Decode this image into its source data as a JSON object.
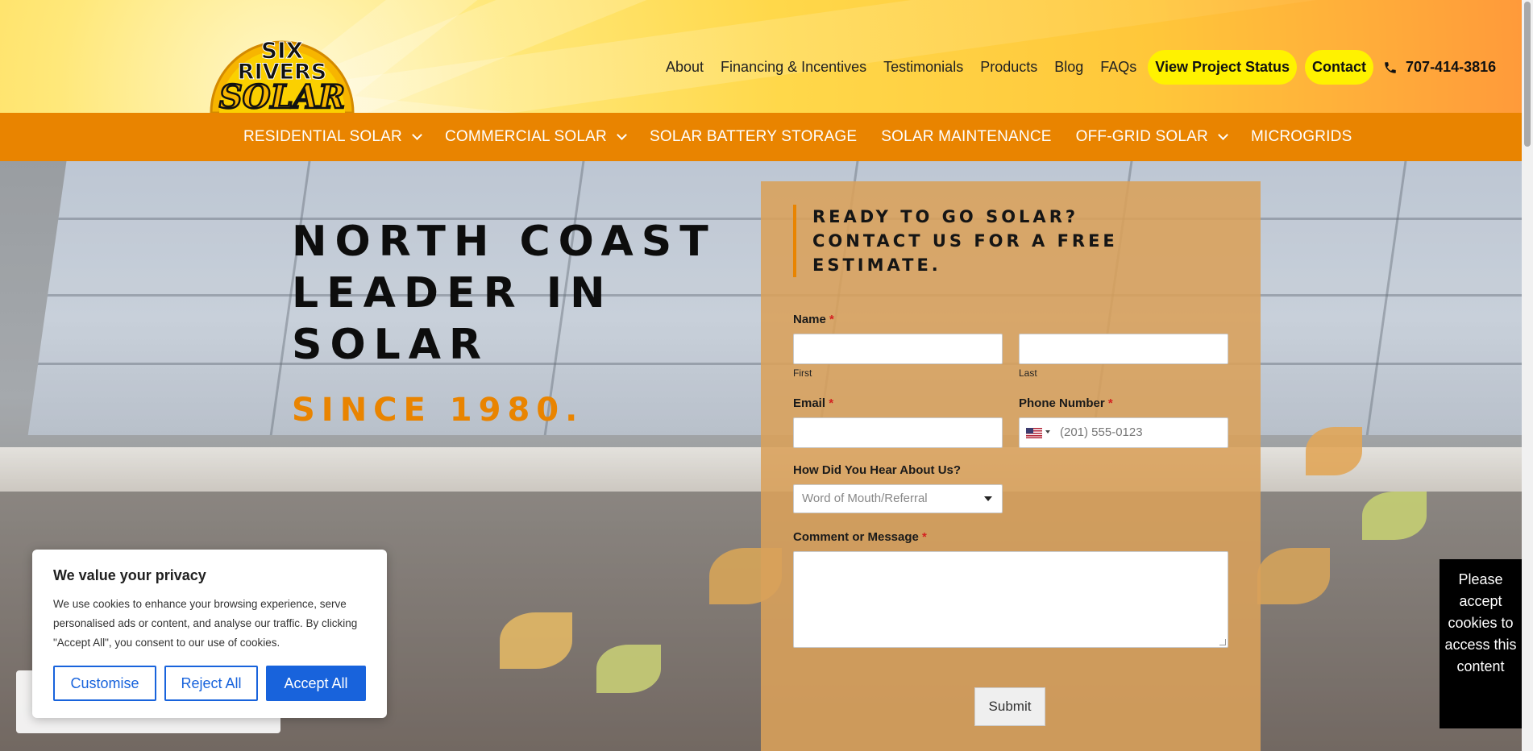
{
  "brand": {
    "logo_line1": "SIX",
    "logo_line2": "RIVERS",
    "logo_line3": "SOLAR"
  },
  "top_nav": {
    "links": [
      "About",
      "Financing & Incentives",
      "Testimonials",
      "Products",
      "Blog",
      "FAQs"
    ],
    "project_status": "View Project Status",
    "contact": "Contact",
    "phone": "707-414-3816"
  },
  "sub_nav": {
    "items": [
      {
        "label": "RESIDENTIAL SOLAR",
        "has_dropdown": true
      },
      {
        "label": "COMMERCIAL SOLAR",
        "has_dropdown": true
      },
      {
        "label": "SOLAR BATTERY STORAGE",
        "has_dropdown": false
      },
      {
        "label": "SOLAR MAINTENANCE",
        "has_dropdown": false
      },
      {
        "label": "OFF-GRID SOLAR",
        "has_dropdown": true
      },
      {
        "label": "MICROGRIDS",
        "has_dropdown": false
      }
    ]
  },
  "hero": {
    "headline_1": "NORTH COAST",
    "headline_2": "LEADER IN",
    "headline_3": "SOLAR",
    "since": "SINCE 1980."
  },
  "form": {
    "title_1": "READY TO GO SOLAR?",
    "title_2": "CONTACT US FOR A FREE",
    "title_3": "ESTIMATE.",
    "name_label": "Name",
    "first_sub": "First",
    "last_sub": "Last",
    "email_label": "Email",
    "phone_label": "Phone Number",
    "phone_placeholder": "(201) 555-0123",
    "hear_label": "How Did You Hear About Us?",
    "hear_selected": "Word of Mouth/Referral",
    "message_label": "Comment or Message",
    "required_mark": "*",
    "submit": "Submit"
  },
  "cookie": {
    "title": "We value your privacy",
    "body": "We use cookies to enhance your browsing experience, serve personalised ads or content, and analyse our traffic. By clicking \"Accept All\", you consent to our use of cookies.",
    "customise": "Customise",
    "reject": "Reject All",
    "accept": "Accept All"
  },
  "cookie_notice": {
    "text": "Please accept cookies to access this content"
  },
  "colors": {
    "orange": "#e98400",
    "yellow_pill": "#fff200",
    "cookie_blue": "#1863dc"
  }
}
